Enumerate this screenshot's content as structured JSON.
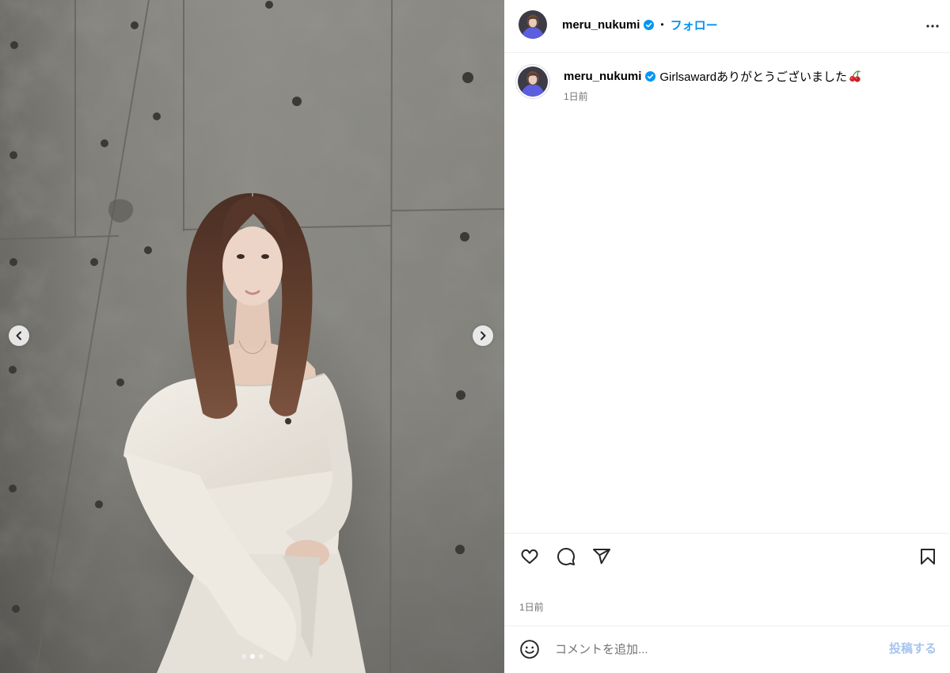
{
  "header": {
    "username": "meru_nukumi",
    "separator": "•",
    "follow_label": "フォロー",
    "avatar_icon": "profile-avatar",
    "verified_icon": "verified-badge-icon",
    "more_icon": "more-options-icon"
  },
  "caption": {
    "username": "meru_nukumi",
    "text": "Girlsawardありがとうございました",
    "emoji_icon": "cherry-emoji-icon",
    "time": "1日前"
  },
  "actions": {
    "like_icon": "heart-icon",
    "comment_icon": "comment-icon",
    "share_icon": "send-icon",
    "save_icon": "bookmark-icon"
  },
  "post_time": "1日前",
  "comment_box": {
    "emoji_icon": "smiley-icon",
    "placeholder": "コメントを追加...",
    "submit_label": "投稿する"
  },
  "carousel": {
    "slide_count": 3,
    "active_slide": 2,
    "prev_icon": "chevron-left-icon",
    "next_icon": "chevron-right-icon"
  },
  "colors": {
    "accent": "#0095f6",
    "submit_disabled": "#a6c4f0",
    "text_primary": "#000000",
    "text_secondary": "#737373",
    "divider": "#efefef"
  }
}
